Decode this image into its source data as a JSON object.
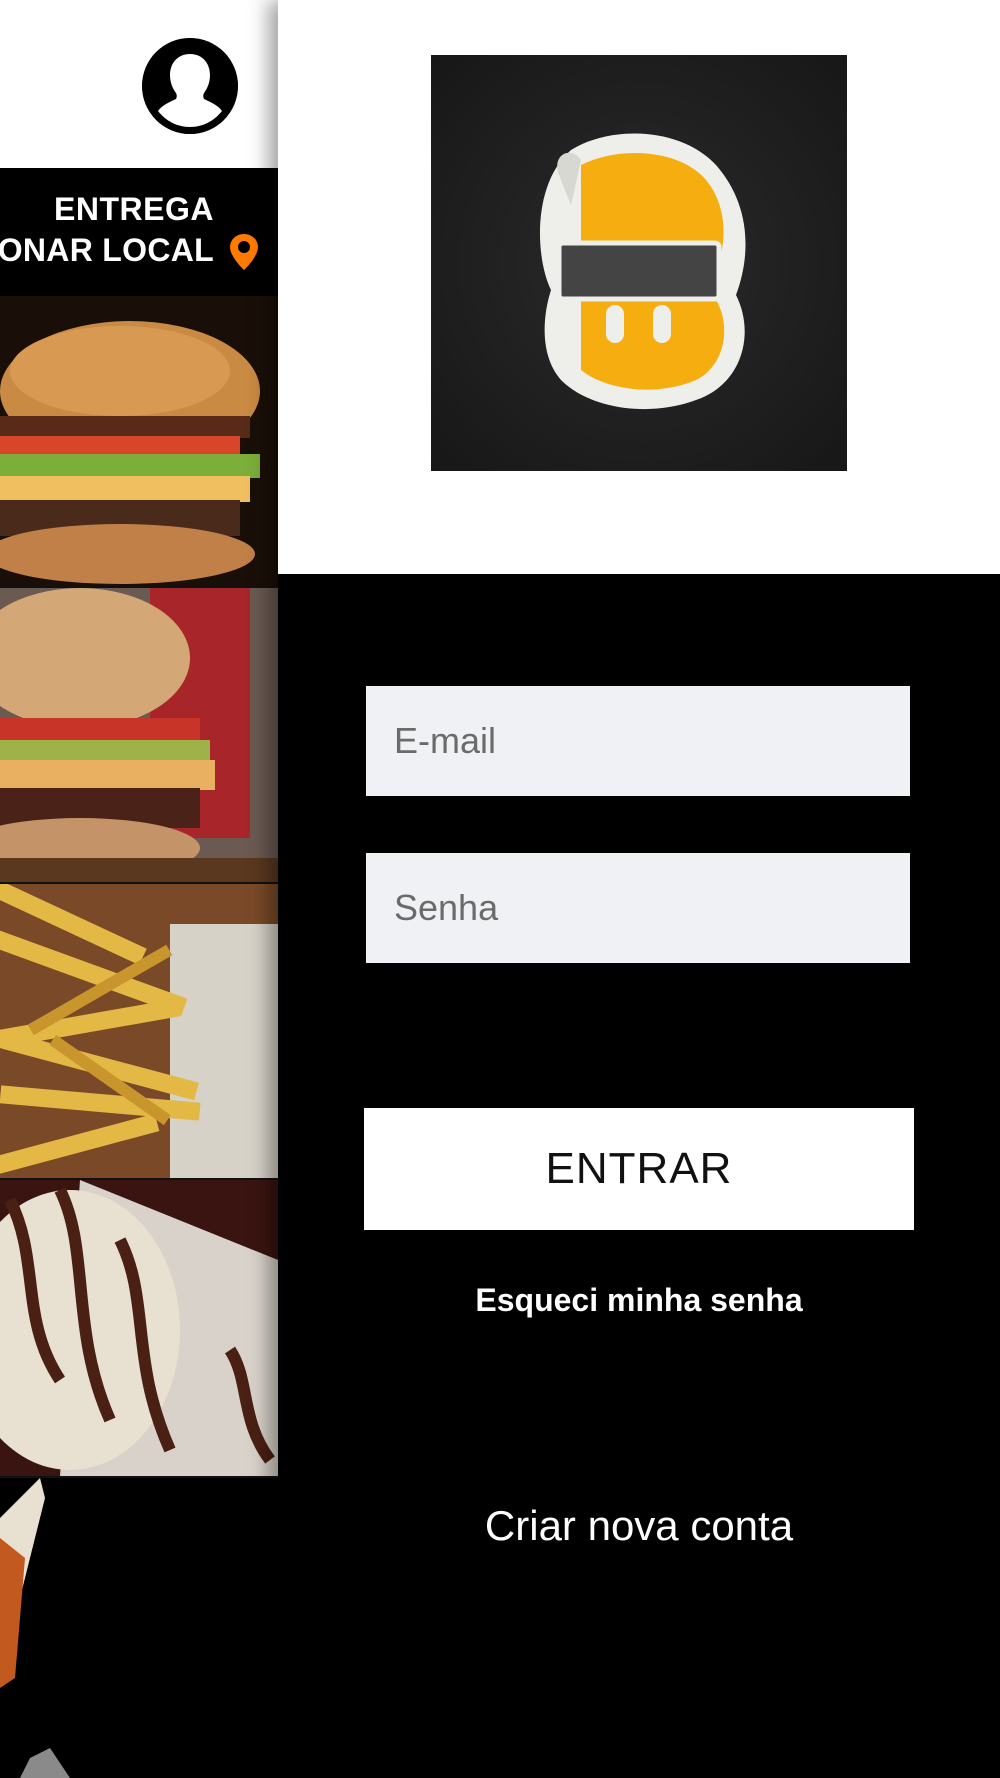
{
  "side_menu": {
    "avatar_icon": "user-silhouette-icon",
    "delivery": {
      "title": "ENTREGA",
      "location_label": "ONAR LOCAL",
      "location_icon": "map-pin-icon",
      "accent_color": "#ff7a00"
    },
    "food_tiles": [
      {
        "name": "burger"
      },
      {
        "name": "burger-with-soda"
      },
      {
        "name": "fries"
      },
      {
        "name": "ice-cream-dessert"
      },
      {
        "name": "drink"
      }
    ]
  },
  "login": {
    "logo_icon": "brand-logo-icon",
    "email": {
      "placeholder": "E-mail",
      "value": ""
    },
    "password": {
      "placeholder": "Senha",
      "value": ""
    },
    "submit_label": "ENTRAR",
    "forgot_password_label": "Esqueci minha senha",
    "create_account_label": "Criar nova conta",
    "colors": {
      "panel_background": "#000000",
      "input_background": "#f0f1f4",
      "button_background": "#ffffff",
      "logo_yellow": "#f5ad0f"
    }
  }
}
